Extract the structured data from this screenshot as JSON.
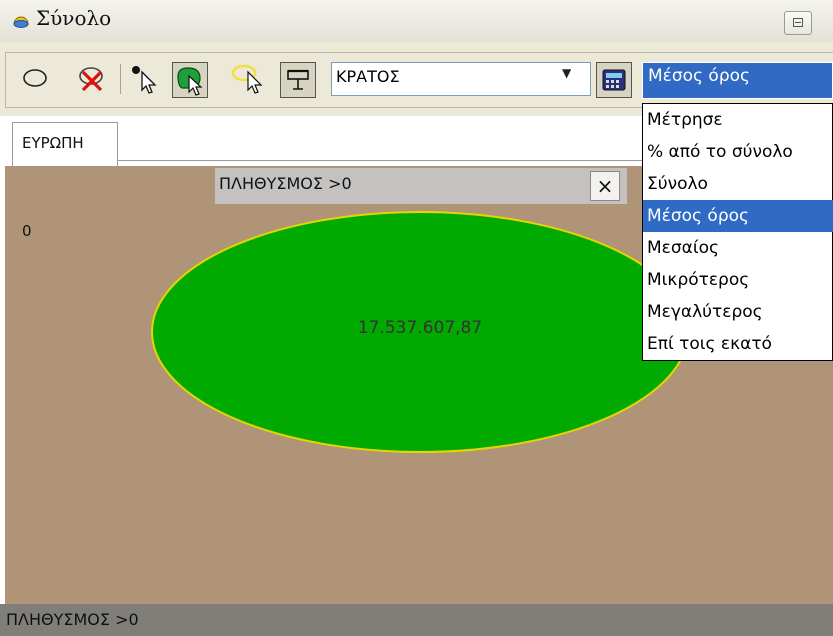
{
  "window": {
    "title": "Σύνολο"
  },
  "toolbar": {
    "state_combo": "ΚΡΑΤΟΣ",
    "aggregate_combo": "Μέσος όρος"
  },
  "tabs": [
    {
      "label": "ΕΥΡΩΠΗ",
      "selected": true
    }
  ],
  "map": {
    "filter_label": "ΠΛΗΘΥΣΜΟΣ >0",
    "close_glyph": "×",
    "legend_value": "0",
    "shape_value": "17.537.607,87",
    "colors": {
      "background": "#b09477",
      "shape_fill": "#00aa00",
      "shape_outline": "#e8d400"
    }
  },
  "aggregate_options": [
    {
      "label": "Μέτρησε",
      "selected": false
    },
    {
      "label": "% από το σύνολο",
      "selected": false
    },
    {
      "label": "Σύνολο",
      "selected": false
    },
    {
      "label": "Μέσος όρος",
      "selected": true
    },
    {
      "label": "Μεσαίος",
      "selected": false
    },
    {
      "label": "Μικρότερος",
      "selected": false
    },
    {
      "label": "Μεγαλύτερος",
      "selected": false
    },
    {
      "label": "Επί τοις εκατό",
      "selected": false
    }
  ],
  "status": {
    "text": "ΠΛΗΘΥΣΜΟΣ >0"
  },
  "icons": [
    "app-icon",
    "restore-icon",
    "ellipse-select-icon",
    "remove-selection-icon",
    "point-select-icon",
    "shape-select-icon",
    "highlight-select-icon",
    "presentation-icon",
    "calculator-icon",
    "dropdown-arrow-icon",
    "close-icon"
  ]
}
